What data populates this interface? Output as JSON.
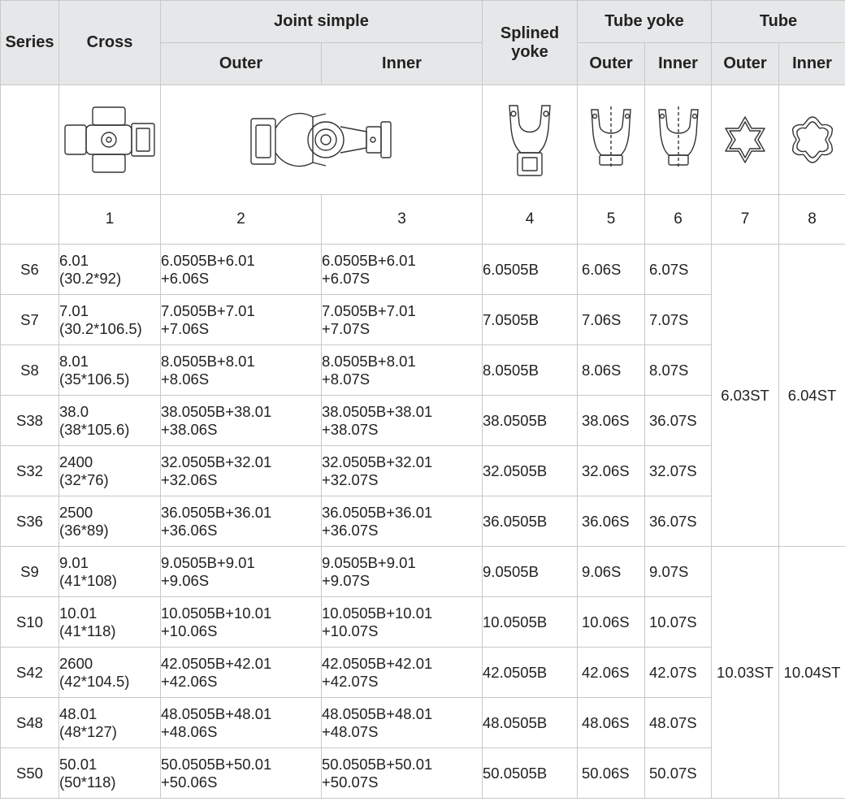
{
  "header": {
    "series": "Series",
    "cross": "Cross",
    "joint_simple": "Joint simple",
    "outer": "Outer",
    "inner": "Inner",
    "splined_yoke_1": "Splined",
    "splined_yoke_2": "yoke",
    "tube_yoke": "Tube yoke",
    "tube": "Tube"
  },
  "icons": [
    "cross-icon",
    "joint-simple-icon",
    "splined-yoke-icon",
    "tube-yoke-outer-icon",
    "tube-yoke-inner-icon",
    "tube-outer-profile-icon",
    "tube-inner-profile-icon"
  ],
  "column_numbers": [
    "1",
    "2",
    "3",
    "4",
    "5",
    "6",
    "7",
    "8"
  ],
  "rows": [
    {
      "series": "S6",
      "cross_1": "6.01",
      "cross_2": "(30.2*92)",
      "outer_1": "6.0505B+6.01",
      "outer_2": "+6.06S",
      "inner_1": "6.0505B+6.01",
      "inner_2": "+6.07S",
      "splined": "6.0505B",
      "ty_outer": "6.06S",
      "ty_inner": "6.07S"
    },
    {
      "series": "S7",
      "cross_1": "7.01",
      "cross_2": "(30.2*106.5)",
      "outer_1": "7.0505B+7.01",
      "outer_2": "+7.06S",
      "inner_1": "7.0505B+7.01",
      "inner_2": "+7.07S",
      "splined": "7.0505B",
      "ty_outer": "7.06S",
      "ty_inner": "7.07S"
    },
    {
      "series": "S8",
      "cross_1": "8.01",
      "cross_2": "(35*106.5)",
      "outer_1": "8.0505B+8.01",
      "outer_2": "+8.06S",
      "inner_1": "8.0505B+8.01",
      "inner_2": "+8.07S",
      "splined": "8.0505B",
      "ty_outer": "8.06S",
      "ty_inner": "8.07S"
    },
    {
      "series": "S38",
      "cross_1": "38.0",
      "cross_2": "(38*105.6)",
      "outer_1": "38.0505B+38.01",
      "outer_2": "+38.06S",
      "inner_1": "38.0505B+38.01",
      "inner_2": "+38.07S",
      "splined": "38.0505B",
      "ty_outer": "38.06S",
      "ty_inner": "36.07S"
    },
    {
      "series": "S32",
      "cross_1": "2400",
      "cross_2": "(32*76)",
      "outer_1": "32.0505B+32.01",
      "outer_2": "+32.06S",
      "inner_1": "32.0505B+32.01",
      "inner_2": "+32.07S",
      "splined": "32.0505B",
      "ty_outer": "32.06S",
      "ty_inner": "32.07S"
    },
    {
      "series": "S36",
      "cross_1": "2500",
      "cross_2": "(36*89)",
      "outer_1": "36.0505B+36.01",
      "outer_2": "+36.06S",
      "inner_1": "36.0505B+36.01",
      "inner_2": "+36.07S",
      "splined": "36.0505B",
      "ty_outer": "36.06S",
      "ty_inner": "36.07S"
    },
    {
      "series": "S9",
      "cross_1": "9.01",
      "cross_2": "(41*108)",
      "outer_1": "9.0505B+9.01",
      "outer_2": "+9.06S",
      "inner_1": "9.0505B+9.01",
      "inner_2": "+9.07S",
      "splined": "9.0505B",
      "ty_outer": "9.06S",
      "ty_inner": "9.07S"
    },
    {
      "series": "S10",
      "cross_1": "10.01",
      "cross_2": "(41*118)",
      "outer_1": "10.0505B+10.01",
      "outer_2": "+10.06S",
      "inner_1": "10.0505B+10.01",
      "inner_2": "+10.07S",
      "splined": "10.0505B",
      "ty_outer": "10.06S",
      "ty_inner": "10.07S"
    },
    {
      "series": "S42",
      "cross_1": "2600",
      "cross_2": "(42*104.5)",
      "outer_1": "42.0505B+42.01",
      "outer_2": "+42.06S",
      "inner_1": "42.0505B+42.01",
      "inner_2": "+42.07S",
      "splined": "42.0505B",
      "ty_outer": "42.06S",
      "ty_inner": "42.07S"
    },
    {
      "series": "S48",
      "cross_1": "48.01",
      "cross_2": "(48*127)",
      "outer_1": "48.0505B+48.01",
      "outer_2": "+48.06S",
      "inner_1": "48.0505B+48.01",
      "inner_2": "+48.07S",
      "splined": "48.0505B",
      "ty_outer": "48.06S",
      "ty_inner": "48.07S"
    },
    {
      "series": "S50",
      "cross_1": "50.01",
      "cross_2": "(50*118)",
      "outer_1": "50.0505B+50.01",
      "outer_2": "+50.06S",
      "inner_1": "50.0505B+50.01",
      "inner_2": "+50.07S",
      "splined": "50.0505B",
      "ty_outer": "50.06S",
      "ty_inner": "50.07S"
    }
  ],
  "tube_groups": [
    {
      "outer": "6.03ST",
      "inner": "6.04ST"
    },
    {
      "outer": "10.03ST",
      "inner": "10.04ST"
    }
  ]
}
